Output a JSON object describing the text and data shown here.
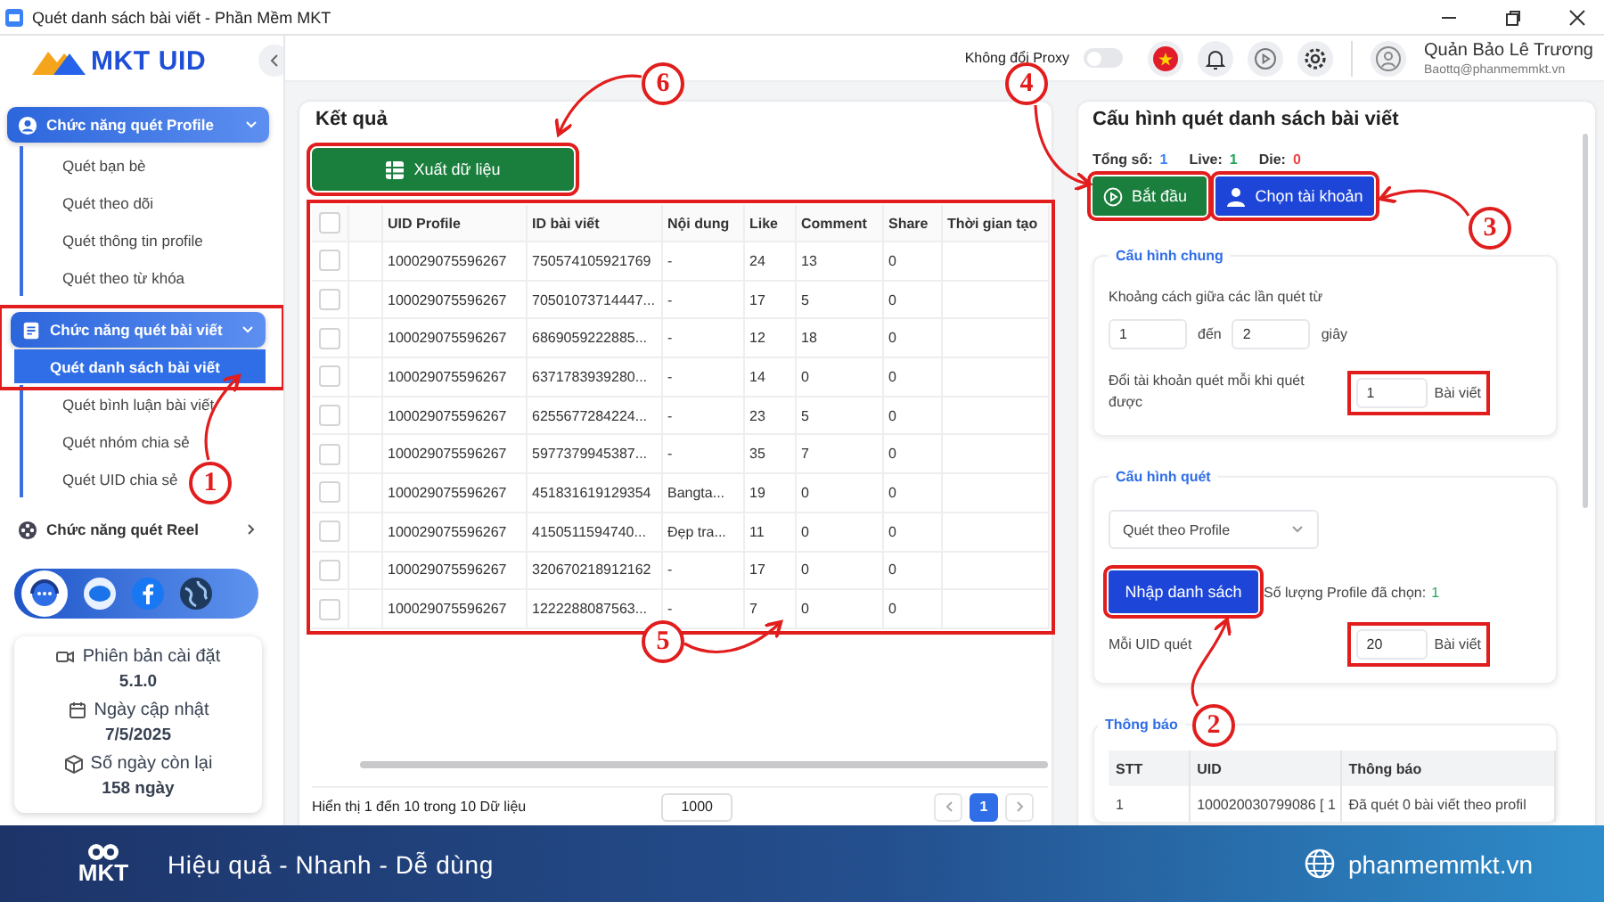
{
  "window": {
    "title": "Quét danh sách bài viết - Phần Mềm MKT"
  },
  "sidebar": {
    "logo": "MKT UID",
    "groups": [
      {
        "label": "Chức năng quét Profile",
        "expanded": true,
        "highlighted": false,
        "children": [
          {
            "label": "Quét bạn bè",
            "selected": false
          },
          {
            "label": "Quét theo dõi",
            "selected": false
          },
          {
            "label": "Quét thông tin profile",
            "selected": false
          },
          {
            "label": "Quét theo từ khóa",
            "selected": false
          }
        ]
      },
      {
        "label": "Chức năng quét bài viết",
        "expanded": true,
        "highlighted": true,
        "children": [
          {
            "label": "Quét danh sách bài viết",
            "selected": true
          },
          {
            "label": "Quét bình luận bài viết",
            "selected": false
          },
          {
            "label": "Quét nhóm chia sẻ",
            "selected": false
          },
          {
            "label": "Quét UID chia sẻ",
            "selected": false
          }
        ]
      },
      {
        "label": "Chức năng quét Reel",
        "expanded": false,
        "highlighted": false
      }
    ],
    "info": [
      {
        "label": "Phiên bản cài đặt",
        "value": "5.1.0"
      },
      {
        "label": "Ngày cập nhật",
        "value": "7/5/2025"
      },
      {
        "label": "Số ngày còn lại",
        "value": "158 ngày"
      }
    ]
  },
  "topbar": {
    "proxy": {
      "label": "Không đổi Proxy",
      "on": false
    },
    "user": {
      "name": "Quản Bảo Lê Trương",
      "email": "Baottq@phanmemmkt.vn"
    }
  },
  "results": {
    "title": "Kết quả",
    "export_button": {
      "label": "Xuất dữ liệu",
      "highlighted": true
    },
    "table": {
      "highlighted": true,
      "all_checked": false,
      "columns": [
        "UID Profile",
        "ID bài viết",
        "Nội dung",
        "Like",
        "Comment",
        "Share",
        "Thời gian tạo"
      ],
      "rows": [
        {
          "checked": false,
          "cells": [
            "100029075596267",
            "750574105921769",
            "-",
            "24",
            "13",
            "0",
            ""
          ]
        },
        {
          "checked": false,
          "cells": [
            "100029075596267",
            "70501073714447...",
            "-",
            "17",
            "5",
            "0",
            ""
          ]
        },
        {
          "checked": false,
          "cells": [
            "100029075596267",
            "6869059222885...",
            "-",
            "12",
            "18",
            "0",
            ""
          ]
        },
        {
          "checked": false,
          "cells": [
            "100029075596267",
            "6371783939280...",
            "-",
            "14",
            "0",
            "0",
            ""
          ]
        },
        {
          "checked": false,
          "cells": [
            "100029075596267",
            "6255677284224...",
            "-",
            "23",
            "5",
            "0",
            ""
          ]
        },
        {
          "checked": false,
          "cells": [
            "100029075596267",
            "5977379945387...",
            "-",
            "35",
            "7",
            "0",
            ""
          ]
        },
        {
          "checked": false,
          "cells": [
            "100029075596267",
            "451831619129354",
            "Bangta...",
            "19",
            "0",
            "0",
            ""
          ]
        },
        {
          "checked": false,
          "cells": [
            "100029075596267",
            "4150511594740...",
            "Đẹp tra...",
            "11",
            "0",
            "0",
            ""
          ]
        },
        {
          "checked": false,
          "cells": [
            "100029075596267",
            "320670218912162",
            "-",
            "17",
            "0",
            "0",
            ""
          ]
        },
        {
          "checked": false,
          "cells": [
            "100029075596267",
            "1222288087563...",
            "-",
            "7",
            "0",
            "0",
            ""
          ]
        }
      ]
    },
    "pagination": {
      "summary": "Hiển thị 1 đến 10 trong 10 Dữ liệu",
      "page_size": "1000",
      "pages": [
        {
          "label": "1",
          "selected": true
        }
      ]
    }
  },
  "config": {
    "title": "Cấu hình quét danh sách bài viết",
    "stats": [
      {
        "label": "Tổng số:",
        "value": "1",
        "color": "#3b82f6"
      },
      {
        "label": "Live:",
        "value": "1",
        "color": "#22a55a"
      },
      {
        "label": "Die:",
        "value": "0",
        "color": "#ef4444"
      }
    ],
    "start_button": {
      "label": "Bắt đầu",
      "highlighted": true
    },
    "account_button": {
      "label": "Chọn tài khoản",
      "highlighted": true
    },
    "general": {
      "title": "Cấu hình chung",
      "interval_label": "Khoảng cách giữa các lần quét từ",
      "interval_from": "1",
      "interval_to_label": "đến",
      "interval_to": "2",
      "interval_unit": "giây",
      "switch_label": "Đổi tài khoản quét mỗi khi quét được",
      "switch_value": "1",
      "switch_unit": "Bài viết",
      "switch_highlighted": true
    },
    "scan": {
      "title": "Cấu hình quét",
      "mode": "Quét theo Profile",
      "import_button": {
        "label": "Nhập danh sách",
        "highlighted": true
      },
      "count_label": "Số lượng Profile đã chọn:",
      "count": "1",
      "per_uid_label": "Mỗi UID quét",
      "per_uid_value": "20",
      "per_uid_unit": "Bài viết",
      "per_uid_highlighted": true
    },
    "log": {
      "title": "Thông báo",
      "columns": [
        "STT",
        "UID",
        "Thông báo"
      ],
      "rows": [
        [
          "1",
          "100020030799086 [ 1",
          "Đã quét 0 bài viết theo profil"
        ]
      ]
    }
  },
  "banner": {
    "logo": "MKT",
    "slogan": "Hiệu quả - Nhanh - Dễ dùng",
    "website": "phanmemmkt.vn"
  },
  "callouts": [
    {
      "number": "1"
    },
    {
      "number": "2"
    },
    {
      "number": "3"
    },
    {
      "number": "4"
    },
    {
      "number": "5"
    },
    {
      "number": "6"
    }
  ]
}
